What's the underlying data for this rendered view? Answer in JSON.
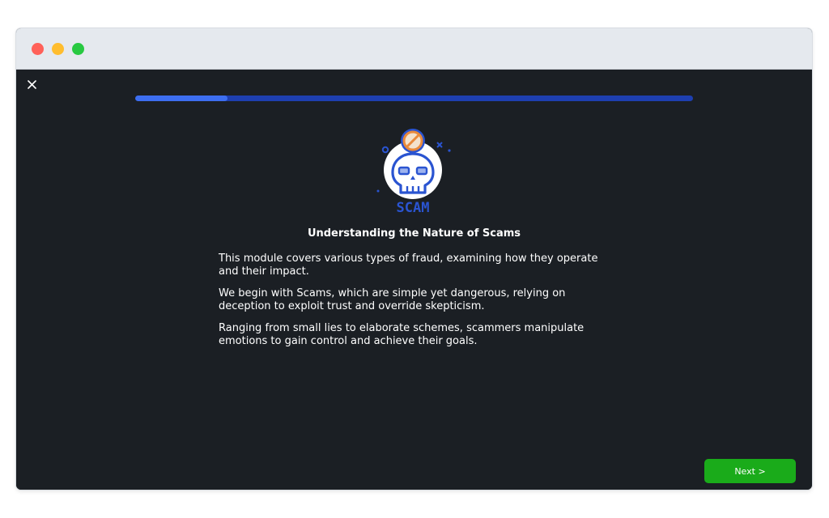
{
  "window": {
    "controls": [
      "close",
      "minimize",
      "maximize"
    ]
  },
  "module": {
    "progress_fraction": 0.165,
    "illustration_label": "SCAM",
    "title": "Understanding the Nature of Scams",
    "paragraphs": [
      "This module covers various types of fraud, examining how they operate and their impact.",
      "We begin with Scams, which are simple yet dangerous, relying on deception to exploit trust and override skepticism.",
      "Ranging from small lies to elaborate schemes, scammers manipulate emotions to gain control and achieve their goals."
    ]
  },
  "actions": {
    "next_label": "Next >"
  },
  "icons": {
    "close": "close-icon",
    "illustration": "skull-scam-icon"
  },
  "colors": {
    "background": "#1b1f24",
    "progress_track": "#1e3fb0",
    "progress_fill": "#3d6ef0",
    "next_button": "#1aab1a",
    "accent_orange": "#e98a3c",
    "accent_blue": "#2a54d1"
  }
}
